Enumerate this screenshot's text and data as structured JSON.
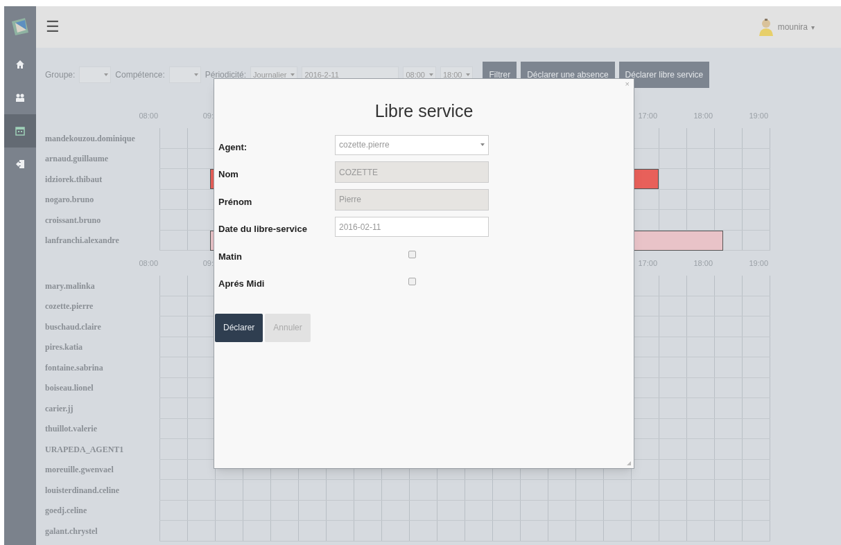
{
  "topbar": {
    "menu": "☰",
    "user": "mounira",
    "caret": "▾"
  },
  "sidebar": {
    "items": [
      {
        "kind": "home",
        "selected": false
      },
      {
        "kind": "users",
        "selected": false
      },
      {
        "kind": "calendar",
        "selected": true
      },
      {
        "kind": "signout",
        "selected": false
      }
    ]
  },
  "filters": [
    {
      "kind": "label",
      "text": "Groupe:"
    },
    {
      "kind": "select"
    },
    {
      "kind": "label",
      "text": "Compétence:"
    },
    {
      "kind": "select"
    },
    {
      "kind": "label",
      "text": "Périodicité:"
    },
    {
      "kind": "select",
      "value": "Journalier"
    },
    {
      "kind": "input",
      "value": "2016-2-11"
    },
    {
      "kind": "select",
      "value": "08:00"
    },
    {
      "kind": "select",
      "value": "18:00"
    },
    {
      "kind": "button",
      "text": "Filtrer"
    },
    {
      "kind": "button",
      "text": "Déclarer une absence"
    },
    {
      "kind": "button",
      "text": "Déclarer libre service"
    }
  ],
  "timeline": {
    "blocks": [
      {
        "ticks": [
          "08:00",
          "09:",
          "17:00",
          "18:00",
          "19:00"
        ],
        "rows": [
          {
            "name": "mandekouzou.dominique"
          },
          {
            "name": "arnaud.guillaume"
          },
          {
            "name": "idziorek.thibaut",
            "bar": {
              "kind": "day",
              "color": "#e8605a"
            }
          },
          {
            "name": "nogaro.bruno"
          },
          {
            "name": "croissant.bruno"
          },
          {
            "name": "lanfranchi.alexandre",
            "bar": {
              "kind": "late",
              "color": "#e9c3c8"
            }
          }
        ]
      },
      {
        "ticks": [
          "08:00",
          "09:",
          "17:00",
          "18:00",
          "19:00"
        ],
        "rows": [
          {
            "name": "mary.malinka"
          },
          {
            "name": "cozette.pierre"
          },
          {
            "name": "buschaud.claire"
          },
          {
            "name": "pires.katia"
          },
          {
            "name": "fontaine.sabrina"
          },
          {
            "name": "boiseau.lionel"
          },
          {
            "name": "carier.jj"
          },
          {
            "name": "thuillot.valerie"
          },
          {
            "name": "URAPEDA_AGENT1"
          },
          {
            "name": "moreuille.gwenvael"
          },
          {
            "name": "louisterdinand.celine"
          },
          {
            "name": "goedj.celine"
          },
          {
            "name": "galant.chrystel"
          }
        ]
      }
    ]
  },
  "modal": {
    "title": "Libre service",
    "close": "×",
    "fields": [
      {
        "kind": "select",
        "label": "Agent:",
        "value": "cozette.pierre"
      },
      {
        "kind": "readonly",
        "label": "Nom",
        "value": "COZETTE"
      },
      {
        "kind": "readonly",
        "label": "Prénom",
        "value": "Pierre"
      },
      {
        "kind": "text",
        "label": "Date du libre-service",
        "value": "2016-02-11"
      },
      {
        "kind": "checkbox",
        "label": "Matin",
        "checked": false
      },
      {
        "kind": "checkbox",
        "label": "Aprés Midi",
        "checked": false
      }
    ],
    "buttons": [
      {
        "label": "Déclarer",
        "primary": true
      },
      {
        "label": "Annuler",
        "primary": false
      }
    ]
  }
}
